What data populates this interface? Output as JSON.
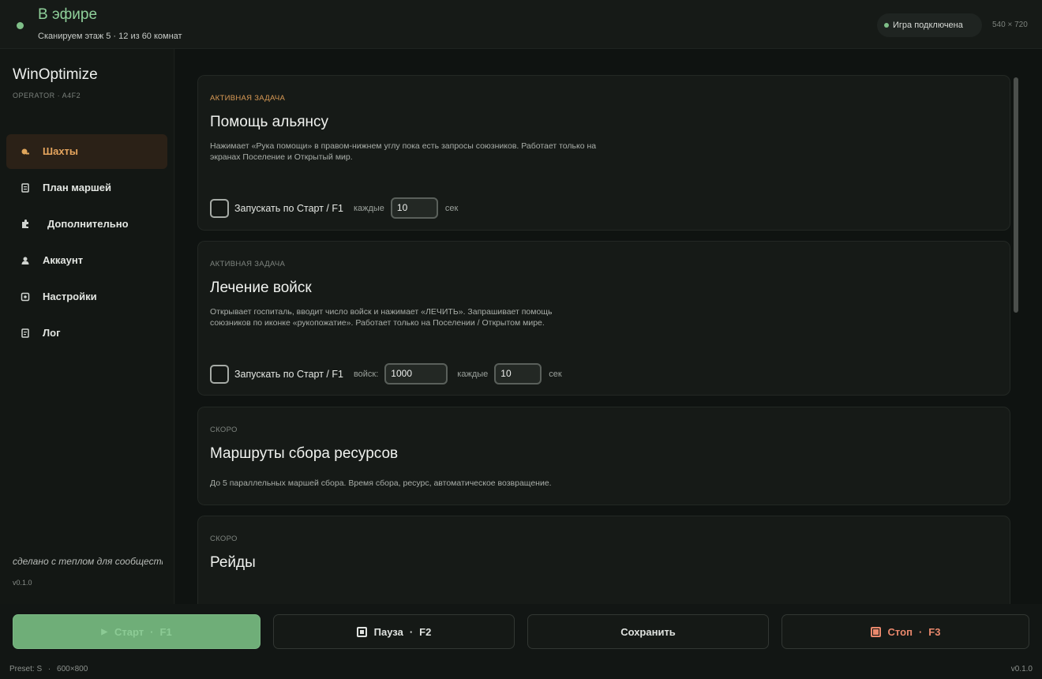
{
  "header": {
    "status_title": "В эфире",
    "status_sub": "Сканируем этаж 5 · 12 из 60 комнат",
    "connection": "Игра подключена",
    "resolution": "540 × 720"
  },
  "sidebar": {
    "brand": "WinOptimize",
    "operator": "OPERATOR · A4F2",
    "items": [
      {
        "label": "Шахты",
        "icon": "mine-icon"
      },
      {
        "label": "План маршей",
        "icon": "plan-icon"
      },
      {
        "label": "Дополнительно",
        "icon": "puzzle-icon"
      },
      {
        "label": "Аккаунт",
        "icon": "user-icon"
      },
      {
        "label": "Настройки",
        "icon": "settings-icon"
      },
      {
        "label": "Лог",
        "icon": "log-icon"
      }
    ],
    "made_with": "сделано с теплом для сообщества",
    "version": "v0.1.0"
  },
  "cards": [
    {
      "tag": "АКТИВНАЯ ЗАДАЧА",
      "title": "Помощь альянсу",
      "desc": "Нажимает «Рука помощи» в правом-нижнем углу пока есть запросы союзников. Работает только на экранах Поселение и Открытый мир.",
      "check_label": "Запускать по Старт / F1",
      "every_label": "каждые",
      "every_value": "10",
      "sec_label": "сек"
    },
    {
      "tag": "АКТИВНАЯ ЗАДАЧА",
      "title": "Лечение войск",
      "desc": "Открывает госпиталь, вводит число войск и нажимает «ЛЕЧИТЬ». Запрашивает помощь союзников по иконке «рукопожатие». Работает только на Поселении / Открытом мире.",
      "check_label": "Запускать по Старт / F1",
      "troops_label": "войск:",
      "troops_value": "1000",
      "every_label": "каждые",
      "every_value": "10",
      "sec_label": "сек"
    },
    {
      "tag": "СКОРО",
      "title": "Маршруты сбора ресурсов",
      "desc": "До 5 параллельных маршей сбора. Время сбора, ресурс, автоматическое возвращение."
    },
    {
      "tag": "СКОРО",
      "title": "Рейды"
    }
  ],
  "buttons": {
    "start": "Старт",
    "start_key": "F1",
    "pause": "Пауза",
    "pause_key": "F2",
    "save": "Сохранить",
    "stop": "Стоп",
    "stop_key": "F3"
  },
  "footer": {
    "preset": "Preset: S",
    "size": "600×800",
    "version": "v0.1.0"
  },
  "colors": {
    "accent": "#e0a65c",
    "live": "#7fbf88",
    "start": "#6fae78",
    "stop": "#e9886c"
  }
}
